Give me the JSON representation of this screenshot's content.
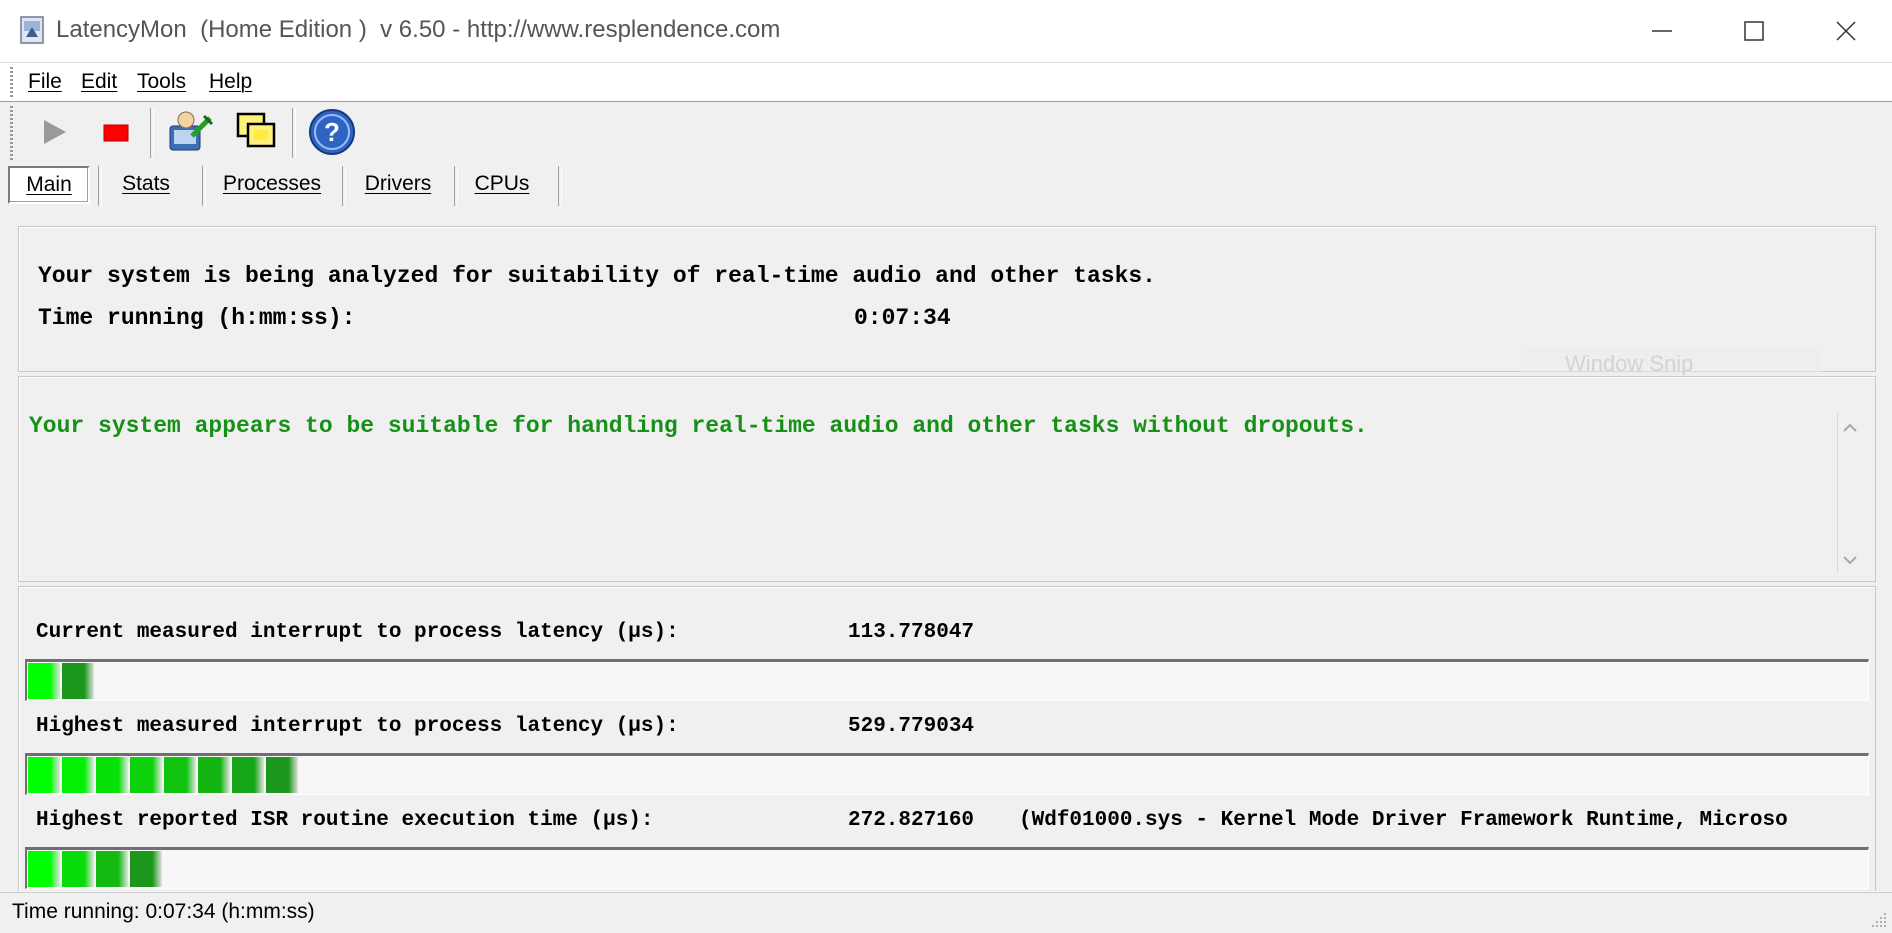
{
  "window": {
    "title": "LatencyMon  (Home Edition )  v 6.50 - http://www.resplendence.com"
  },
  "menu": [
    "File",
    "Edit",
    "Tools",
    "Help"
  ],
  "toolbar": {
    "icons": [
      "play-icon",
      "stop-icon",
      "user-settings-icon",
      "window-copy-icon",
      "help-icon"
    ]
  },
  "tabs": [
    "Main",
    "Stats",
    "Processes",
    "Drivers",
    "CPUs"
  ],
  "analysis": {
    "message": "Your system is being analyzed for suitability of real-time audio and other tasks.",
    "time_label": "Time running (h:mm:ss):",
    "time_value": "0:07:34"
  },
  "overlay": {
    "text": "Window Snip"
  },
  "verdict": {
    "message": "Your system appears to be suitable for handling real-time audio and other tasks without dropouts.",
    "color": "#169016"
  },
  "metrics": [
    {
      "label": "Current measured interrupt to process latency (µs):",
      "value": "113.778047",
      "extra": "",
      "segments": 2
    },
    {
      "label": "Highest measured interrupt to process latency (µs):",
      "value": "529.779034",
      "extra": "",
      "segments": 8
    },
    {
      "label": "Highest reported ISR routine execution time (µs):",
      "value": "272.827160",
      "extra": "(Wdf01000.sys - Kernel Mode Driver Framework Runtime, Microso",
      "segments": 4
    }
  ],
  "status": {
    "text": "Time running: 0:07:34  (h:mm:ss)"
  },
  "colors": {
    "bar_light": "#00ff00",
    "bar_dark": "#1e8c1e"
  }
}
